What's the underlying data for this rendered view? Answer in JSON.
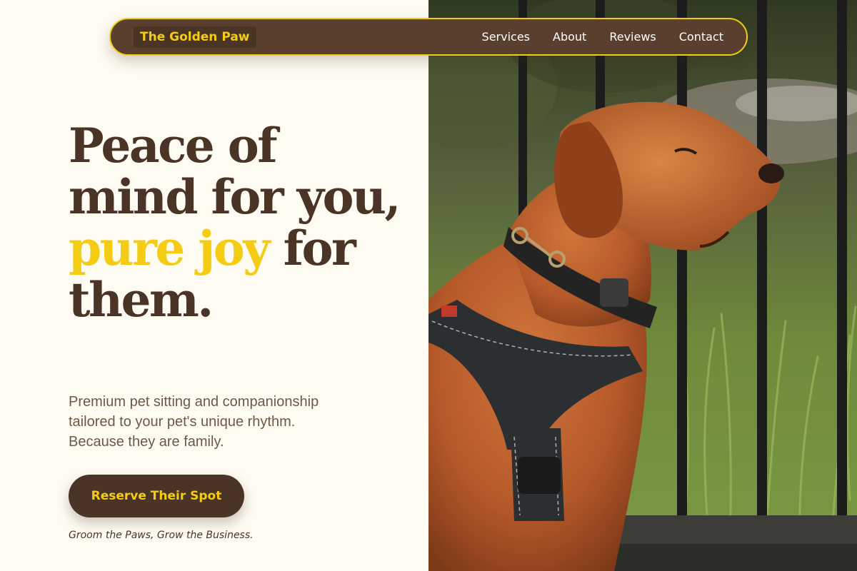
{
  "nav": {
    "brand": "The Golden Paw",
    "links": [
      "Services",
      "About",
      "Reviews",
      "Contact"
    ]
  },
  "hero": {
    "headline_part1": "Peace of mind for you, ",
    "headline_accent": "pure joy",
    "headline_part2": " for them.",
    "subtitle": "Premium pet sitting and companionship tailored to your pet's unique rhythm. Because they are family.",
    "cta_label": "Reserve Their Spot",
    "tagline": "Groom the Paws, Grow the Business.",
    "image_alt": "dog-photo"
  },
  "colors": {
    "background": "#fdfbf2",
    "brown": "#4a3426",
    "nav_brown": "#5b3f2e",
    "gold": "#f4cc14",
    "body_text": "#6e5848"
  }
}
